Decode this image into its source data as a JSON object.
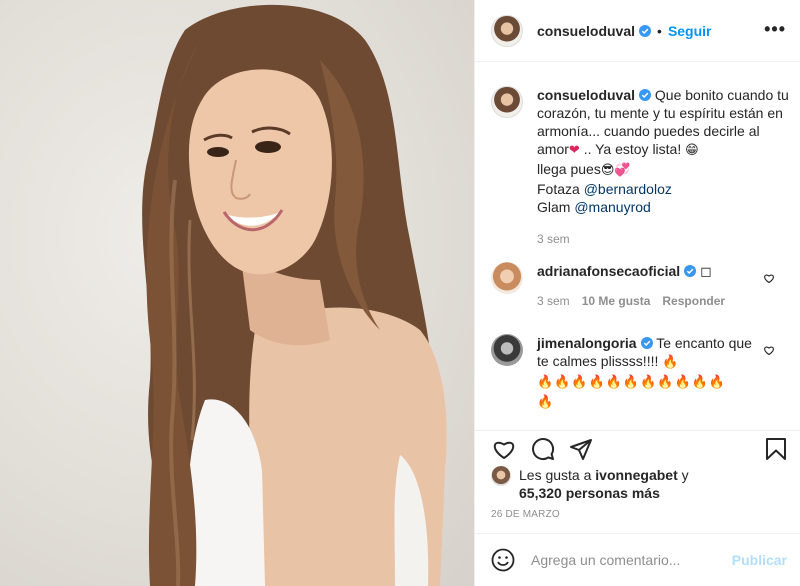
{
  "header": {
    "username": "consueloduval",
    "follow_label": "Seguir",
    "more_label": "•••"
  },
  "caption": {
    "username": "consueloduval",
    "text_1": "Que bonito cuando tu corazón, tu mente y tu espíritu están en armonía... cuando puedes decirle al amor",
    "emoji_heart": "❤",
    "text_2": ".. Ya estoy lista!",
    "emoji_grin": "😁",
    "text_3": "llega pues",
    "emoji_cool": "😎",
    "emoji_hearts": "💞",
    "text_4": "Fotaza",
    "mention_1": "@bernardoloz",
    "text_5": "Glam",
    "mention_2": "@manuyrod",
    "time": "3 sem"
  },
  "comments": [
    {
      "username": "adrianafonsecaoficial",
      "text": "◻",
      "time": "3 sem",
      "likes": "10 Me gusta",
      "reply": "Responder"
    },
    {
      "username": "jimenalongoria",
      "text": "Te encanto que te calmes plissss!!!!",
      "fire_1": "🔥",
      "fire_2": "🔥🔥🔥🔥🔥🔥🔥🔥🔥🔥🔥",
      "fire_3": "🔥"
    }
  ],
  "likes": {
    "prefix": "Les gusta a",
    "user": "ivonnegabet",
    "conj": "y",
    "count": "65,320 personas más"
  },
  "date": "26 DE MARZO",
  "composer": {
    "placeholder": "Agrega un comentario...",
    "publish_label": "Publicar"
  },
  "colors": {
    "accent": "#0095f6",
    "publish_disabled": "#b2dffc",
    "muted": "#8e8e8e",
    "text": "#262626"
  },
  "icons": [
    "verified-icon",
    "heart-icon",
    "comment-icon",
    "share-icon",
    "save-icon",
    "emoji-icon",
    "more-icon"
  ]
}
